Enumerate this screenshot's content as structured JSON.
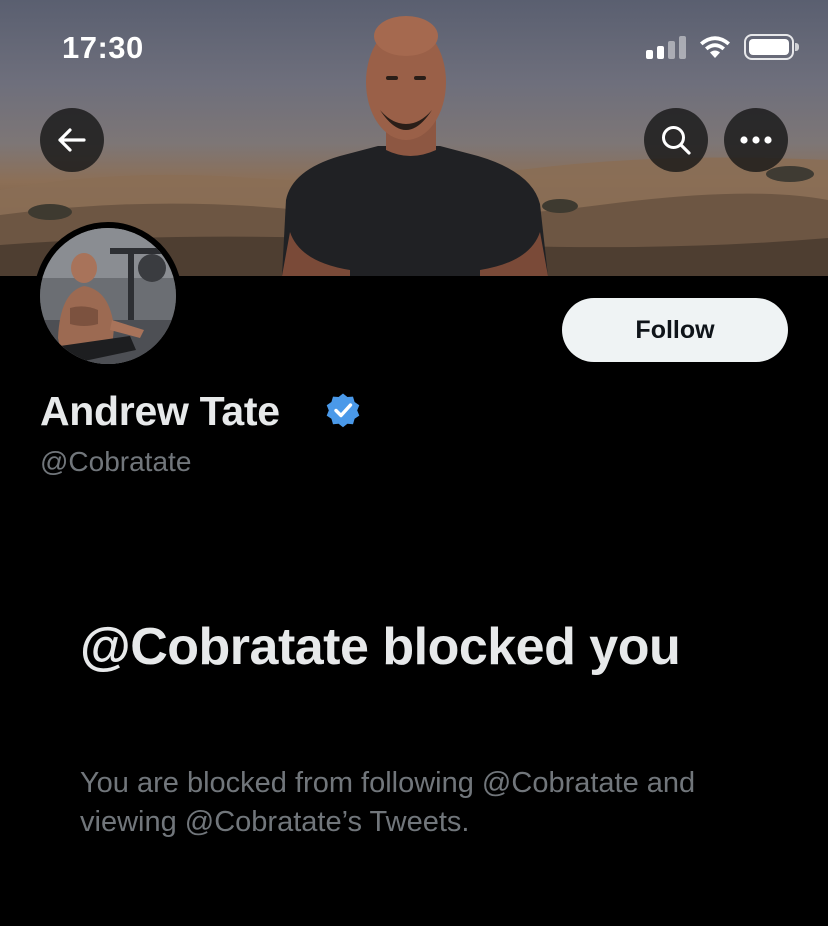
{
  "status_bar": {
    "time": "17:30"
  },
  "header": {
    "back_icon": "arrow-left-icon",
    "search_icon": "search-icon",
    "more_icon": "more-horizontal-icon"
  },
  "profile": {
    "display_name": "Andrew Tate",
    "handle": "@Cobratate",
    "verified": true,
    "verified_color": "#4a99e9",
    "follow_label": "Follow"
  },
  "blocked_notice": {
    "title": "@Cobratate blocked you",
    "description": "You are blocked from following @Cobratate and viewing @Cobratate’s Tweets."
  },
  "colors": {
    "background": "#000000",
    "primary_text": "#e7e9ea",
    "secondary_text": "#71767b",
    "follow_button_bg": "#eff3f4",
    "follow_button_text": "#0f1419"
  }
}
